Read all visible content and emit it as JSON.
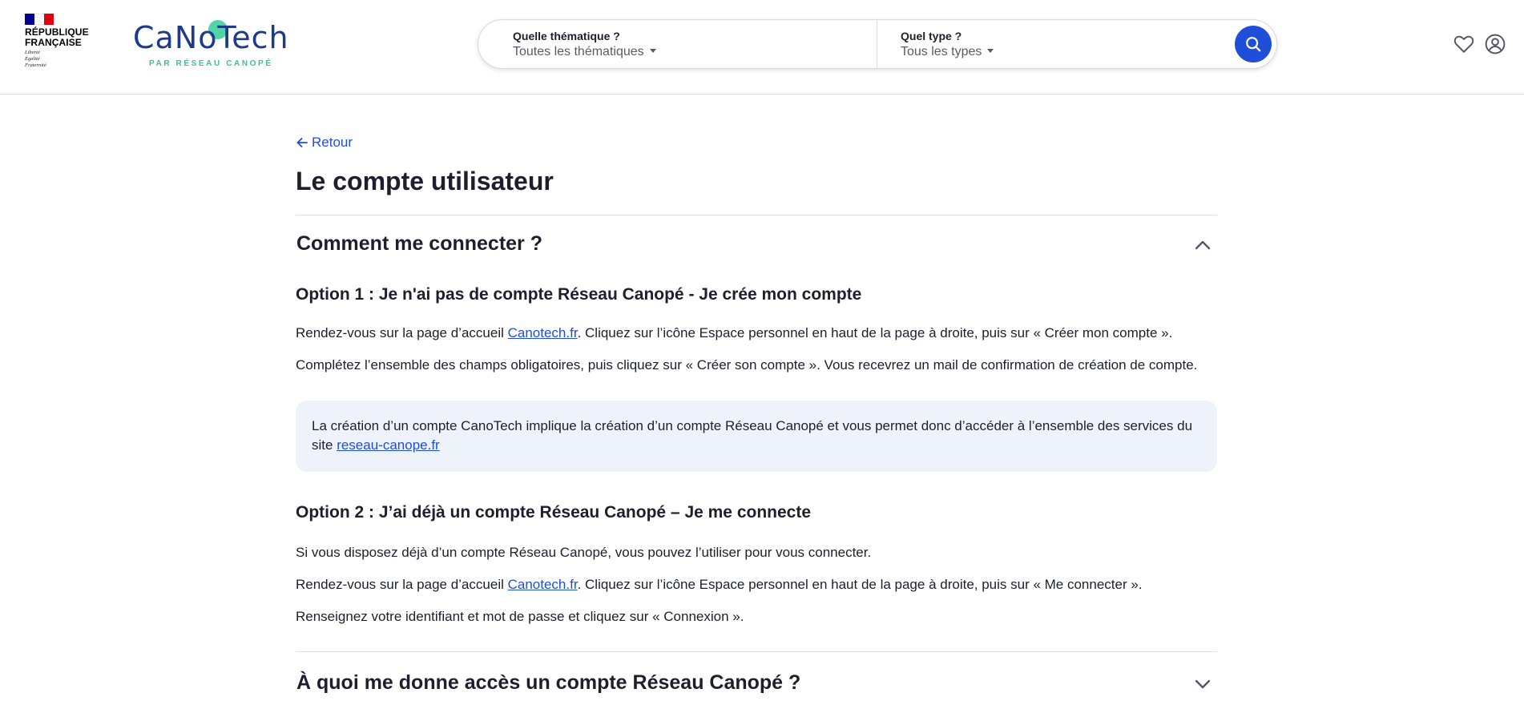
{
  "header": {
    "republique": {
      "name_line1": "RÉPUBLIQUE",
      "name_line2": "FRANÇAISE",
      "motto_line1": "Liberté",
      "motto_line2": "Égalité",
      "motto_line3": "Fraternité"
    },
    "brand": {
      "name": "CaNoTech",
      "tagline": "PAR RÉSEAU CANOPÉ"
    },
    "search": {
      "theme_label": "Quelle thématique ?",
      "theme_value": "Toutes les thématiques",
      "type_label": "Quel type ?",
      "type_value": "Tous les types",
      "button_icon": "search-icon"
    },
    "icons": [
      "heart-icon",
      "user-icon"
    ]
  },
  "main": {
    "back_label": "Retour",
    "title": "Le compte utilisateur",
    "accordion": [
      {
        "title": "Comment me connecter ?",
        "expanded": true,
        "option1": {
          "title": "Option 1 : Je n'ai pas de compte Réseau Canopé - Je crée mon compte",
          "p1_before": "Rendez-vous sur la page d’accueil ",
          "p1_link": "Canotech.fr",
          "p1_after": ". Cliquez sur l’icône Espace personnel en haut de la page à droite, puis sur « Créer mon compte ».",
          "p2": "Complétez l’ensemble des champs obligatoires, puis cliquez sur « Créer son compte ». Vous recevrez un mail de confirmation de création de compte.",
          "callout_text": "La création d’un compte CanoTech implique la création d’un compte Réseau Canopé et vous permet donc d’accéder à l’ensemble des services du site ",
          "callout_link": "reseau-canope.fr"
        },
        "option2": {
          "title": "Option 2 : J’ai déjà un compte Réseau Canopé – Je me connecte",
          "p1": "Si vous disposez déjà d’un compte Réseau Canopé, vous pouvez l’utiliser pour vous connecter.",
          "p2_before": "Rendez-vous sur la page d’accueil ",
          "p2_link": "Canotech.fr",
          "p2_after": ". Cliquez sur l’icône Espace personnel en haut de la page à droite, puis sur « Me connecter ».",
          "p3": "Renseignez votre identifiant et mot de passe et cliquez sur « Connexion »."
        }
      },
      {
        "title": "À quoi me donne accès un compte Réseau Canopé ?",
        "expanded": false
      }
    ]
  },
  "colors": {
    "accent": "#1f4fd8",
    "brand_navy": "#1e3a8a",
    "brand_green": "#3bbf9a",
    "callout_bg": "#eef2fb",
    "text": "#1e1e2e"
  }
}
